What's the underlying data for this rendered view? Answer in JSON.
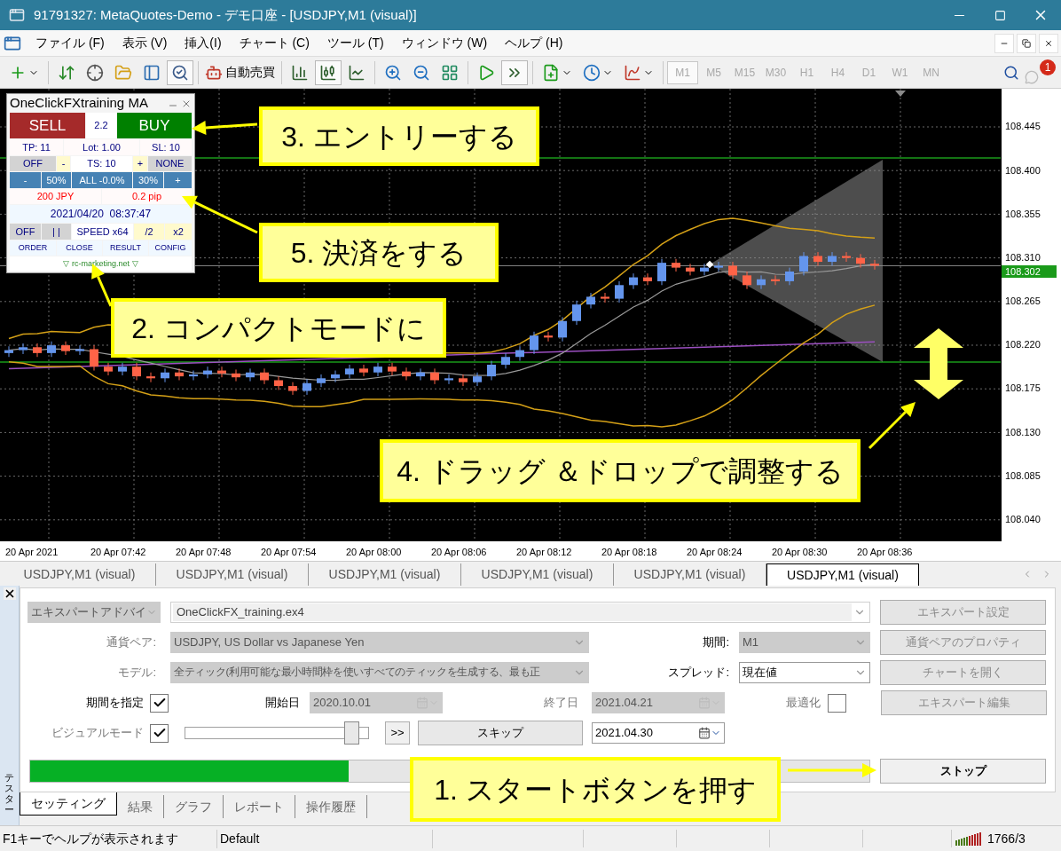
{
  "window": {
    "title": "91791327: MetaQuotes-Demo - デモ口座 - [USDJPY,M1 (visual)]"
  },
  "menu": [
    "ファイル (F)",
    "表示 (V)",
    "挿入(I)",
    "チャート (C)",
    "ツール (T)",
    "ウィンドウ (W)",
    "ヘルプ (H)"
  ],
  "toolbar": {
    "tools": [
      {
        "selected": false
      },
      {
        "selected": false
      },
      {
        "selected": false
      },
      {
        "selected": false
      },
      {
        "selected": false
      },
      {
        "selected": true
      },
      {
        "selected": false
      },
      {
        "selected": true
      },
      {
        "selected": false
      },
      {
        "selected": false
      },
      {
        "selected": false
      },
      {
        "selected": false
      },
      {
        "selected": false
      },
      {
        "selected": true
      },
      {
        "selected": false
      },
      {
        "selected": false
      },
      {
        "selected": false
      }
    ],
    "auto_trading": "自動売買",
    "timeframes": [
      {
        "label": "M1",
        "selected": true
      },
      {
        "label": "M5",
        "selected": false
      },
      {
        "label": "M15",
        "selected": false
      },
      {
        "label": "M30",
        "selected": false
      },
      {
        "label": "H1",
        "selected": false
      },
      {
        "label": "H4",
        "selected": false
      },
      {
        "label": "D1",
        "selected": false
      },
      {
        "label": "W1",
        "selected": false
      },
      {
        "label": "MN",
        "selected": false
      }
    ],
    "notifications": "1"
  },
  "chart": {
    "price_labels": [
      "108.445",
      "108.400",
      "108.355",
      "108.310",
      "108.265",
      "108.220",
      "108.175",
      "108.130",
      "108.085",
      "108.040"
    ],
    "current_price": "108.302",
    "time_labels": [
      "20 Apr 2021",
      "20 Apr 07:42",
      "20 Apr 07:48",
      "20 Apr 07:54",
      "20 Apr 08:00",
      "20 Apr 08:06",
      "20 Apr 08:12",
      "20 Apr 08:18",
      "20 Apr 08:24",
      "20 Apr 08:30",
      "20 Apr 08:36"
    ]
  },
  "panel": {
    "title": "OneClickFXtraining MA",
    "trade": [
      {
        "text": "SELL",
        "kind": "sell"
      },
      {
        "text": "2.2",
        "kind": "value"
      },
      {
        "text": "BUY",
        "kind": "buy"
      }
    ],
    "targets": [
      {
        "text": "TP: 11",
        "kind": "label"
      },
      {
        "text": "Lot: 1.00",
        "kind": "label"
      },
      {
        "text": "SL: 10",
        "kind": "label"
      }
    ],
    "trailing": [
      {
        "text": "OFF",
        "kind": "toggle"
      },
      {
        "text": "-",
        "kind": "step"
      },
      {
        "text": "TS: 10",
        "kind": "value"
      },
      {
        "text": "+",
        "kind": "step"
      },
      {
        "text": "NONE",
        "kind": "toggle"
      }
    ],
    "close_ratio": [
      {
        "text": "-",
        "kind": "ratio"
      },
      {
        "text": "50%",
        "kind": "ratio"
      },
      {
        "text": "ALL -0.0%",
        "kind": "ratio"
      },
      {
        "text": "30%",
        "kind": "ratio"
      },
      {
        "text": "+",
        "kind": "ratio"
      }
    ],
    "profit": [
      {
        "text": "200 JPY",
        "kind": "loss"
      },
      {
        "text": "0.2 pip",
        "kind": "loss"
      }
    ],
    "clock": [
      {
        "text": "2021/04/20  08:37:47",
        "kind": "clock"
      }
    ],
    "replay": [
      {
        "text": "OFF",
        "kind": "toggle"
      },
      {
        "text": "| |",
        "kind": "toggle"
      },
      {
        "text": "SPEED x64",
        "kind": "value"
      },
      {
        "text": "/2",
        "kind": "step"
      },
      {
        "text": "x2",
        "kind": "step"
      }
    ],
    "menu": [
      {
        "text": "ORDER",
        "kind": "menu"
      },
      {
        "text": "CLOSE",
        "kind": "menu"
      },
      {
        "text": "RESULT",
        "kind": "menu"
      },
      {
        "text": "CONFIG",
        "kind": "menu"
      }
    ],
    "link": [
      {
        "text": "▽ rc-marketing.net ▽",
        "kind": "link"
      }
    ]
  },
  "callouts": [
    {
      "text": "3. エントリーする"
    },
    {
      "text": "5. 決済をする"
    },
    {
      "text": "2. コンパクトモードに"
    },
    {
      "text": "4. ドラッグ ＆ドロップで調整する"
    },
    {
      "text": "1. スタートボタンを押す"
    }
  ],
  "chart_tabs": [
    {
      "label": "USDJPY,M1 (visual)",
      "selected": false
    },
    {
      "label": "USDJPY,M1 (visual)",
      "selected": false
    },
    {
      "label": "USDJPY,M1 (visual)",
      "selected": false
    },
    {
      "label": "USDJPY,M1 (visual)",
      "selected": false
    },
    {
      "label": "USDJPY,M1 (visual)",
      "selected": false
    },
    {
      "label": "USDJPY,M1 (visual)",
      "selected": true
    }
  ],
  "tester": {
    "side_label": "テスター",
    "expert_type": {
      "value": "エキスパートアドバイ",
      "disabled": true
    },
    "expert": {
      "value": "OneClickFX_training.ex4"
    },
    "symbol": {
      "label": "通貨ペア:",
      "value": "USDJPY, US Dollar vs Japanese Yen",
      "disabled": true
    },
    "period": {
      "label": "期間:",
      "value": "M1",
      "disabled": true
    },
    "model": {
      "label": "モデル:",
      "value": "全ティック(利用可能な最小時間枠を使いすべてのティックを生成する、最も正",
      "disabled": true
    },
    "spread": {
      "label": "スプレッド:",
      "value": "現在値",
      "disabled": false
    },
    "use_date": {
      "label": "期間を指定",
      "checked": true
    },
    "from": {
      "label": "開始日",
      "value": "2020.10.01",
      "disabled": true
    },
    "to": {
      "label": "終了日",
      "value": "2021.04.21",
      "disabled": true
    },
    "optimization": {
      "label": "最適化",
      "checked": false
    },
    "visual": {
      "label": "ビジュアルモード",
      "checked": true
    },
    "speed": {
      "level": 0.94
    },
    "fast_forward": ">>",
    "skip": "スキップ",
    "skip_to": {
      "value": "2021.04.30",
      "disabled": false
    },
    "progress": {
      "level": 0.38
    },
    "buttons": [
      {
        "label": "エキスパート設定",
        "disabled": true
      },
      {
        "label": "通貨ペアのプロパティ",
        "disabled": true
      },
      {
        "label": "チャートを開く",
        "disabled": true
      },
      {
        "label": "エキスパート編集",
        "disabled": true
      }
    ],
    "stop": "ストップ",
    "tabs": [
      {
        "label": "セッティング",
        "selected": true
      },
      {
        "label": "結果",
        "selected": false
      },
      {
        "label": "グラフ",
        "selected": false
      },
      {
        "label": "レポート",
        "selected": false
      },
      {
        "label": "操作履歴",
        "selected": false
      }
    ]
  },
  "status_bar": {
    "help": "F1キーでヘルプが表示されます",
    "profile": "Default",
    "traffic": "1766/3"
  }
}
